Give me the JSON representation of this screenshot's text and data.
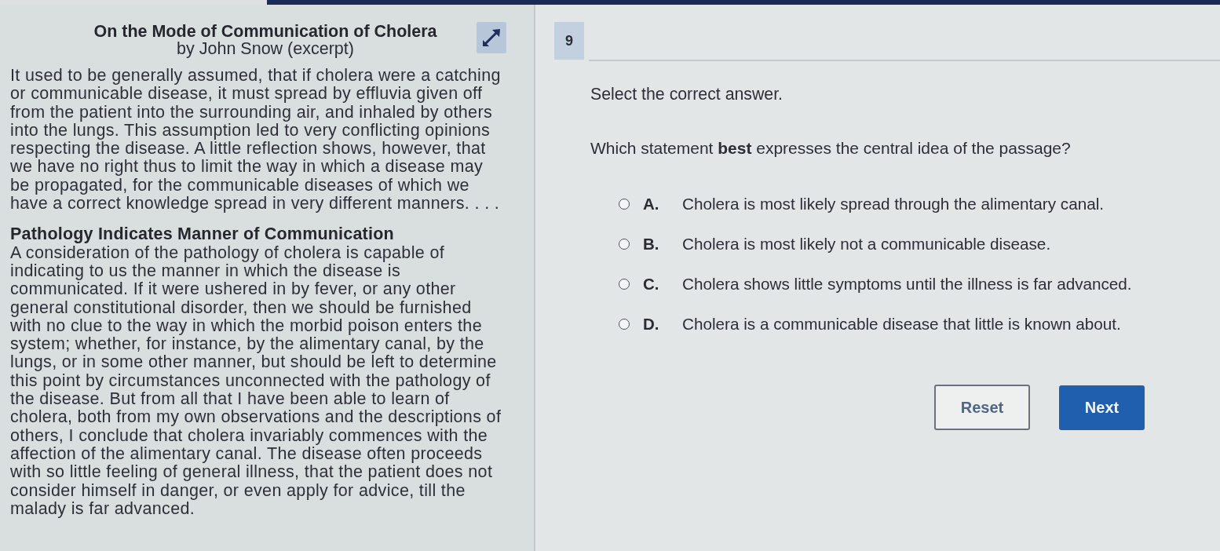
{
  "passage": {
    "title": "On the Mode of Communication of Cholera",
    "subtitle": "by John Snow (excerpt)",
    "blocks": [
      {
        "kind": "text",
        "text": "It used to be generally assumed, that if cholera were a catching\nor communicable disease, it must spread by effluvia given off\nfrom the patient into the surrounding air, and inhaled by others\ninto the lungs. This assumption led to very conflicting opinions\nrespecting the disease. A little reflection shows, however, that\nwe have no right thus to limit the way in which a disease may\nbe propagated, for the communicable diseases of which we\nhave a correct knowledge spread in very different manners. . . ."
      },
      {
        "kind": "heading",
        "text": "Pathology Indicates Manner of Communication"
      },
      {
        "kind": "text",
        "text": "A consideration of the pathology of cholera is capable of\nindicating to us the manner in which the disease is\ncommunicated. If it were ushered in by fever, or any other\ngeneral constitutional disorder, then we should be furnished\nwith no clue to the way in which the morbid poison enters the\nsystem; whether, for instance, by the alimentary canal, by the\nlungs, or in some other manner, but should be left to determine\nthis point by circumstances unconnected with the pathology of\nthe disease. But from all that I have been able to learn of\ncholera, both from my own observations and the descriptions of\nothers, I conclude that cholera invariably commences with the\naffection of the alimentary canal. The disease often proceeds\nwith so little feeling of general illness, that the patient does not\nconsider himself in danger, or even apply for advice, till the\nmalady is far advanced."
      }
    ]
  },
  "question": {
    "number": "9",
    "instruction": "Select the correct answer.",
    "prompt": "Which statement **best** expresses the central idea of the passage?",
    "options": [
      {
        "letter": "A.",
        "text": "Cholera is most likely spread through the alimentary canal.",
        "selected": false
      },
      {
        "letter": "B.",
        "text": "Cholera is most likely not a communicable disease.",
        "selected": false
      },
      {
        "letter": "C.",
        "text": "Cholera shows little symptoms until the illness is far advanced.",
        "selected": false
      },
      {
        "letter": "D.",
        "text": "Cholera is a communicable disease that little is known about.",
        "selected": false
      }
    ]
  },
  "buttons": [
    {
      "kind": "secondary",
      "label": "Reset"
    },
    {
      "kind": "primary",
      "label": "Next"
    }
  ]
}
